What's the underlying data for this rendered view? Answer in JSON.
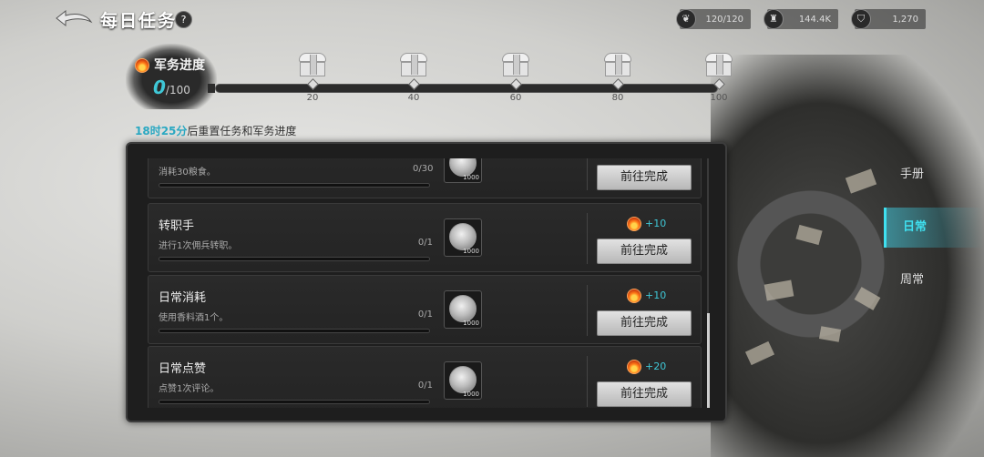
{
  "header": {
    "title": "每日任务",
    "help_symbol": "?",
    "resources": [
      {
        "icon": "wheat-icon",
        "value": "120/120"
      },
      {
        "icon": "tower-icon",
        "value": "144.4K"
      },
      {
        "icon": "shield-icon",
        "value": "1,270"
      }
    ]
  },
  "military": {
    "label": "军务进度",
    "current": "0",
    "max": "/100",
    "milestones": [
      "20",
      "40",
      "60",
      "80",
      "100"
    ]
  },
  "reset": {
    "time": "18时25分",
    "text": "后重置任务和军务进度"
  },
  "action_label": "前往完成",
  "tasks": [
    {
      "name": "",
      "desc": "消耗30粮食。",
      "count": "0/30",
      "reward": "",
      "coin_qty": "1000"
    },
    {
      "name": "转职手",
      "desc": "进行1次佣兵转职。",
      "count": "0/1",
      "reward": "+10",
      "coin_qty": "1000"
    },
    {
      "name": "日常消耗",
      "desc": "使用香料酒1个。",
      "count": "0/1",
      "reward": "+10",
      "coin_qty": "1000"
    },
    {
      "name": "日常点赞",
      "desc": "点赞1次评论。",
      "count": "0/1",
      "reward": "+20",
      "coin_qty": "1000"
    }
  ],
  "side_tabs": {
    "manual": "手册",
    "daily": "日常",
    "weekly": "周常",
    "active": "daily"
  },
  "colors": {
    "accent": "#3fc7d6",
    "panel": "#1e1e1e"
  }
}
